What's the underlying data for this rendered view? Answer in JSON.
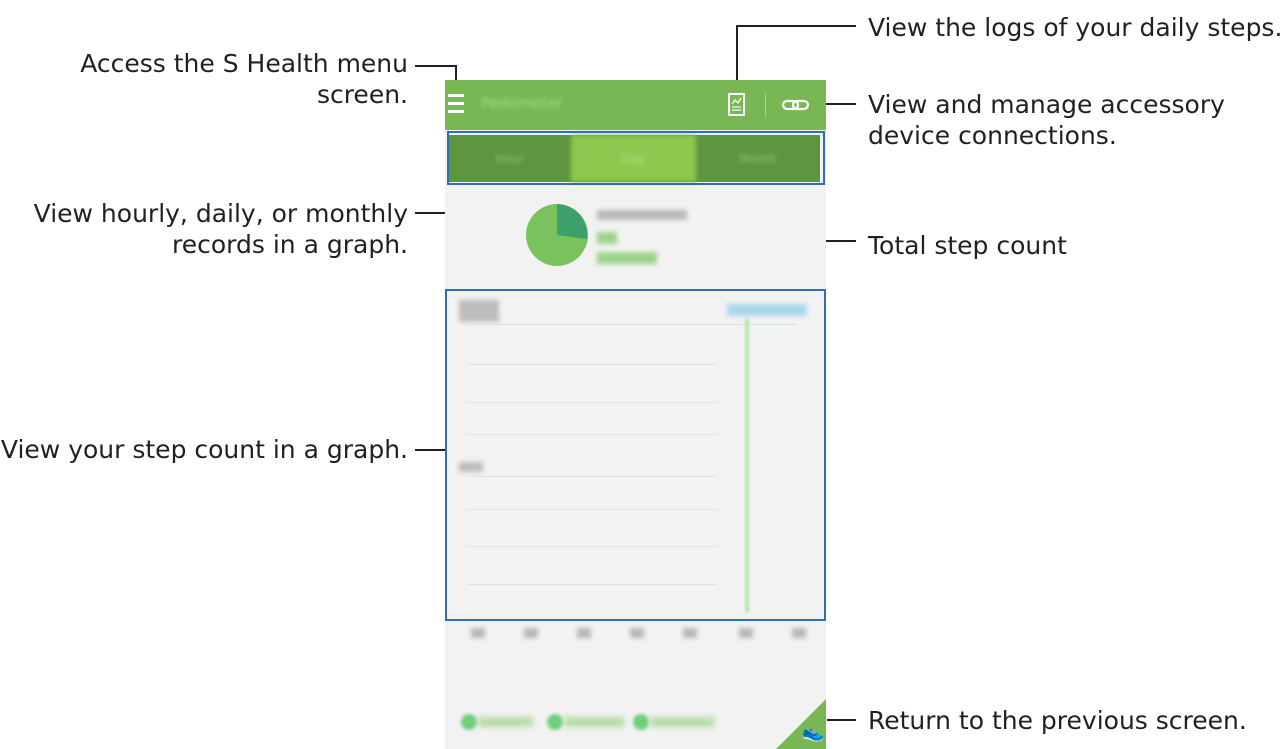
{
  "callouts": {
    "menu": "Access the S Health menu screen.",
    "menu_line1": "Access the S Health menu",
    "menu_line2": "screen.",
    "graph_period_line1": "View hourly, daily, or monthly",
    "graph_period_line2": "records in a graph.",
    "step_graph": "View your step count in a graph.",
    "logs": "View the logs of your daily steps.",
    "accessory_line1": "View and manage accessory",
    "accessory_line2": "device connections.",
    "total": "Total step count",
    "back": "Return to the previous screen."
  },
  "icons": {
    "menu": "menu-icon",
    "logs": "logs-icon",
    "accessory": "link-icon",
    "back": "shoe-icon"
  },
  "colors": {
    "action_bar": "#78b754",
    "tab_bar": "#5e953f",
    "tab_selected": "#8dc84f",
    "highlight": "#2f6db5"
  }
}
